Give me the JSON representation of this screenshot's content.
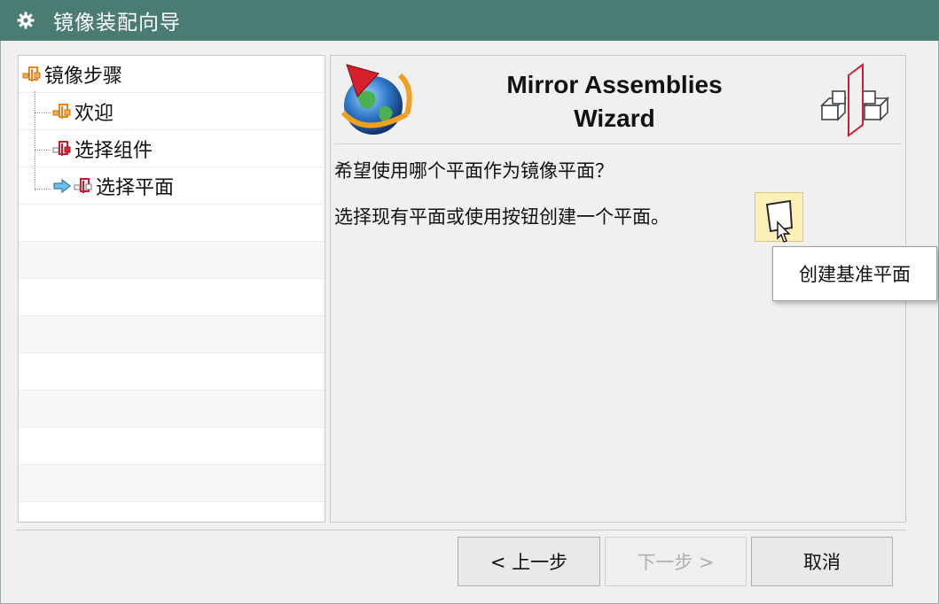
{
  "window": {
    "title": "镜像装配向导",
    "title_bar_color": "#4a7c74"
  },
  "steps": {
    "root_label": "镜像步骤",
    "items": [
      {
        "label": "欢迎"
      },
      {
        "label": "选择组件"
      },
      {
        "label": "选择平面",
        "current": true
      }
    ]
  },
  "wizard": {
    "title_line1": "Mirror Assemblies",
    "title_line2": "Wizard",
    "question": "希望使用哪个平面作为镜像平面？",
    "instruction": "选择现有平面或使用按钮创建一个平面。",
    "tooltip": "创建基准平面"
  },
  "buttons": {
    "back": "< 上一步",
    "next": "下一步 >",
    "cancel": "取消"
  }
}
